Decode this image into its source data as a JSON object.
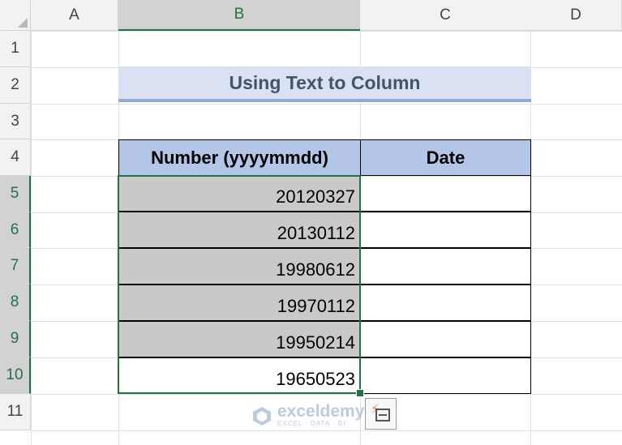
{
  "columns": [
    {
      "label": "A",
      "selected": false
    },
    {
      "label": "B",
      "selected": true
    },
    {
      "label": "C",
      "selected": false
    },
    {
      "label": "D",
      "selected": false
    }
  ],
  "rows": [
    {
      "label": "1",
      "selected": false
    },
    {
      "label": "2",
      "selected": false
    },
    {
      "label": "3",
      "selected": false
    },
    {
      "label": "4",
      "selected": false
    },
    {
      "label": "5",
      "selected": true
    },
    {
      "label": "6",
      "selected": true
    },
    {
      "label": "7",
      "selected": true
    },
    {
      "label": "8",
      "selected": true
    },
    {
      "label": "9",
      "selected": true
    },
    {
      "label": "10",
      "selected": true
    },
    {
      "label": "11",
      "selected": false
    }
  ],
  "title": "Using Text to Column",
  "table": {
    "headers": [
      "Number (yyyymmdd)",
      "Date"
    ],
    "rows": [
      {
        "number": "20120327",
        "date": "",
        "shaded": true
      },
      {
        "number": "20130112",
        "date": "",
        "shaded": true
      },
      {
        "number": "19980612",
        "date": "",
        "shaded": true
      },
      {
        "number": "19970112",
        "date": "",
        "shaded": true
      },
      {
        "number": "19950214",
        "date": "",
        "shaded": true
      },
      {
        "number": "19650523",
        "date": "",
        "shaded": false
      }
    ]
  },
  "flash_fill_icon": "flash-fill-options-icon",
  "watermark": {
    "name": "exceldemy",
    "tagline": "EXCEL · DATA · BI"
  },
  "colors": {
    "accent": "#217346",
    "title_bg": "#d9e1f2",
    "header_bg": "#b4c6e7",
    "shade": "#c9c9c9"
  }
}
